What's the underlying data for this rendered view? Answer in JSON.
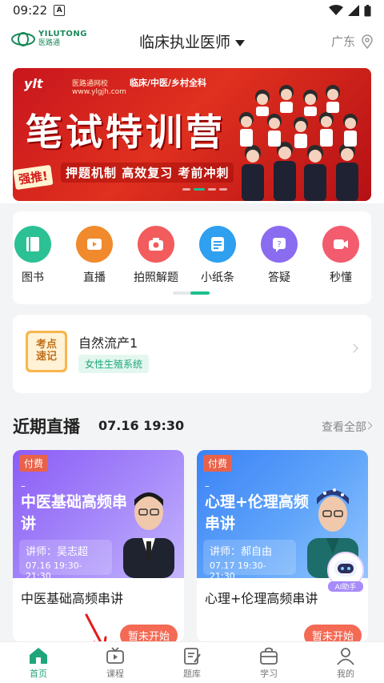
{
  "status_bar": {
    "time": "09:22",
    "notif": "A"
  },
  "header": {
    "logo_en": "YILUTONG",
    "logo_cn": "医路通",
    "title": "临床执业医师",
    "location": "广东"
  },
  "banner": {
    "brand": "ylt",
    "brand_name": "医路通网校",
    "brand_url": "www.ylgjh.com",
    "categories": "临床/中医/乡村全科",
    "headline": "笔试特训营",
    "slogan": "押题机制 高效复习 考前冲刺",
    "tag": "强推!"
  },
  "quick_icons": [
    {
      "label": "图书",
      "icon": "book-icon",
      "color": "#2cc195"
    },
    {
      "label": "直播",
      "icon": "play-icon",
      "color": "#f08a2c"
    },
    {
      "label": "拍照解题",
      "icon": "camera-icon",
      "color": "#f25c5c"
    },
    {
      "label": "小纸条",
      "icon": "note-icon",
      "color": "#2f9ff0"
    },
    {
      "label": "答疑",
      "icon": "qa-icon",
      "color": "#8a6cf0"
    },
    {
      "label": "秒懂",
      "icon": "video-icon",
      "color": "#f25c6e"
    }
  ],
  "knowledge": {
    "badge_line1": "考点",
    "badge_line2": "速记",
    "title": "自然流产1",
    "tag": "女性生殖系统"
  },
  "live_section": {
    "heading": "近期直播",
    "time": "07.16 19:30",
    "view_all": "查看全部"
  },
  "live_cards": [
    {
      "badge": "付费",
      "dash": "–",
      "cover_title": "中医基础高频串讲",
      "teacher": "讲师：吴志超",
      "schedule": "07.16 19:30-21:30",
      "name": "中医基础高频串讲",
      "state": "暂未开始"
    },
    {
      "badge": "付费",
      "dash": "–",
      "cover_title": "心理+伦理高频串讲",
      "teacher": "讲师：郝自由",
      "schedule": "07.17 19:30-21:30",
      "name": "心理+伦理高频串讲",
      "state": "暂未开始"
    }
  ],
  "ai_helper": "AI助手",
  "tabbar": [
    {
      "label": "首页",
      "icon": "home-icon",
      "active": true
    },
    {
      "label": "课程",
      "icon": "tv-icon",
      "active": false
    },
    {
      "label": "题库",
      "icon": "edit-icon",
      "active": false
    },
    {
      "label": "学习",
      "icon": "bag-icon",
      "active": false
    },
    {
      "label": "我的",
      "icon": "person-icon",
      "active": false
    }
  ],
  "colors": {
    "accent": "#1fa57a",
    "banner_red": "#d42419",
    "paid": "#e8624a",
    "state": "#f46a55"
  }
}
